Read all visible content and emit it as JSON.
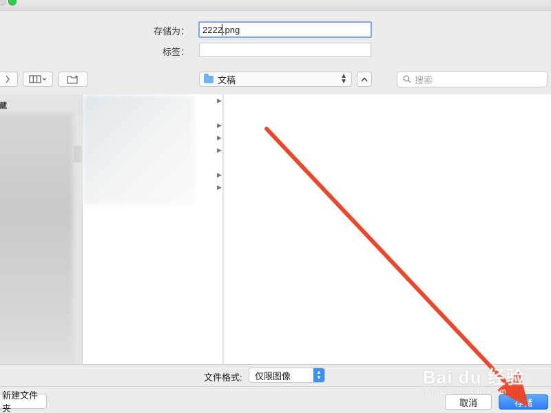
{
  "save_as": {
    "label": "存储为：",
    "value": "2222.png"
  },
  "tags": {
    "label": "标签：",
    "value": ""
  },
  "location": {
    "current": "文稿"
  },
  "search": {
    "placeholder": "搜索"
  },
  "sidebar": {
    "heading": "收藏"
  },
  "file_format": {
    "label": "文件格式:",
    "selected": "仅限图像"
  },
  "buttons": {
    "new_folder": "新建文件夹",
    "cancel": "取消",
    "save": "存储"
  },
  "watermark": {
    "main": "Bai du 经验",
    "sub": "jingyan.baidu.com"
  },
  "colors": {
    "accent": "#3d8ef5",
    "annotation_arrow": "#e8492d",
    "field_focus": "#7fa6e6"
  }
}
